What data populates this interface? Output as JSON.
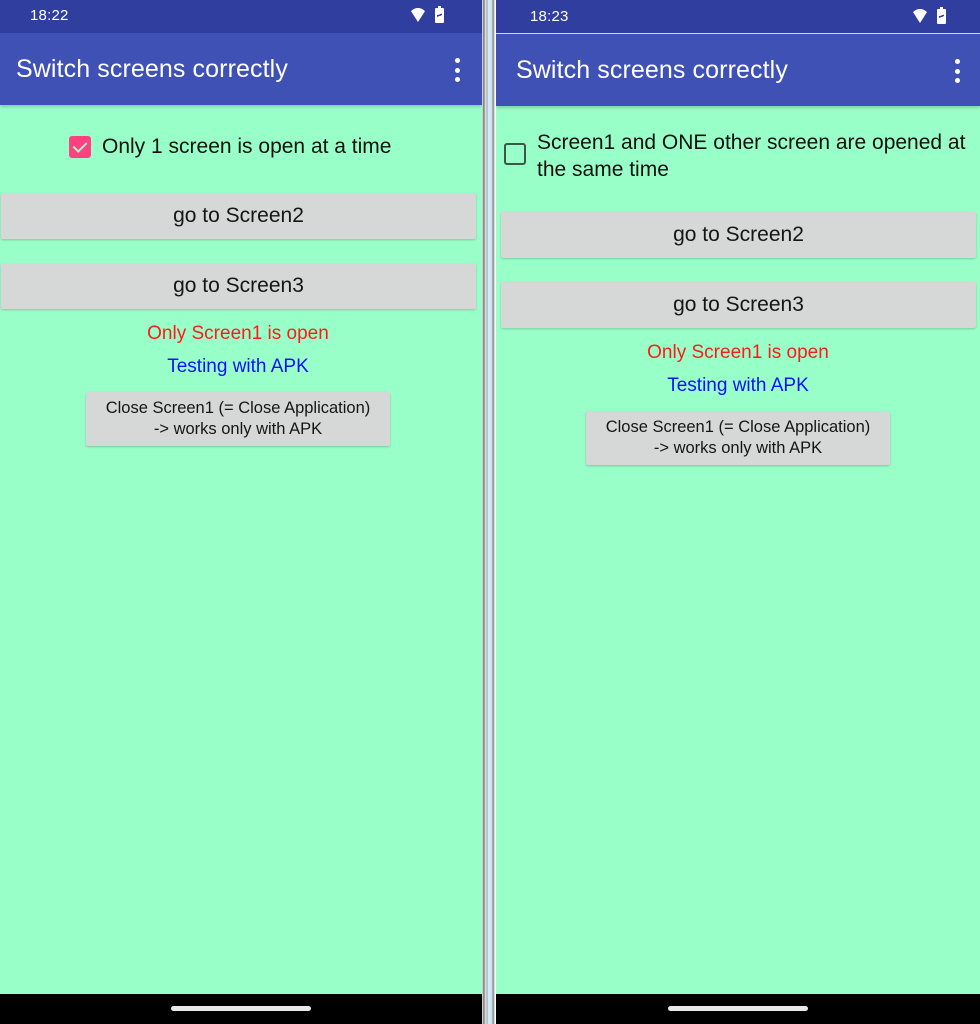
{
  "screens": [
    {
      "status_bar": {
        "time": "18:22",
        "icons": [
          "wifi-icon",
          "battery-charging-icon"
        ]
      },
      "app_bar": {
        "title": "Switch screens correctly",
        "overflow_icon": "more-vert-icon"
      },
      "checkbox": {
        "label": "Only 1 screen is open at a time",
        "checked": true,
        "color": "#ff4081"
      },
      "buttons": {
        "screen2": "go to Screen2",
        "screen3": "go to Screen3"
      },
      "status_text": "Only Screen1 is open",
      "testing_text": "Testing with APK",
      "close_button": {
        "line1": "Close Screen1 (= Close Application)",
        "line2": "-> works only with APK"
      }
    },
    {
      "status_bar": {
        "time": "18:23",
        "icons": [
          "wifi-icon",
          "battery-charging-icon"
        ]
      },
      "app_bar": {
        "title": "Switch screens correctly",
        "overflow_icon": "more-vert-icon"
      },
      "checkbox": {
        "label": "Screen1 and ONE other screen are opened at the same time",
        "checked": false
      },
      "buttons": {
        "screen2": "go to Screen2",
        "screen3": "go to Screen3"
      },
      "status_text": "Only Screen1 is open",
      "testing_text": "Testing with APK",
      "close_button": {
        "line1": "Close Screen1 (= Close Application)",
        "line2": "-> works only with APK"
      }
    }
  ],
  "colors": {
    "status_bar": "#303f9f",
    "app_bar": "#3f51b5",
    "background": "#99ffc8",
    "button": "#d6d7d7",
    "status_text": "#ff1a1a",
    "testing_text": "#1010ff"
  }
}
